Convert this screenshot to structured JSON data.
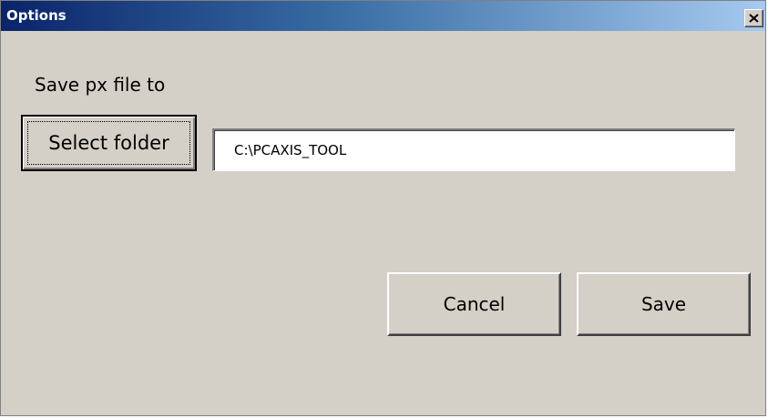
{
  "window": {
    "title": "Options",
    "close_icon": "close-icon"
  },
  "form": {
    "save_label": "Save px file to",
    "select_folder_label": "Select folder",
    "folder_path_value": "C:\\PCAXIS_TOOL",
    "cancel_label": "Cancel",
    "save_button_label": "Save"
  },
  "colors": {
    "face": "#d4d0c8",
    "titlebar_start": "#0a246a",
    "titlebar_end": "#a6caf0"
  }
}
